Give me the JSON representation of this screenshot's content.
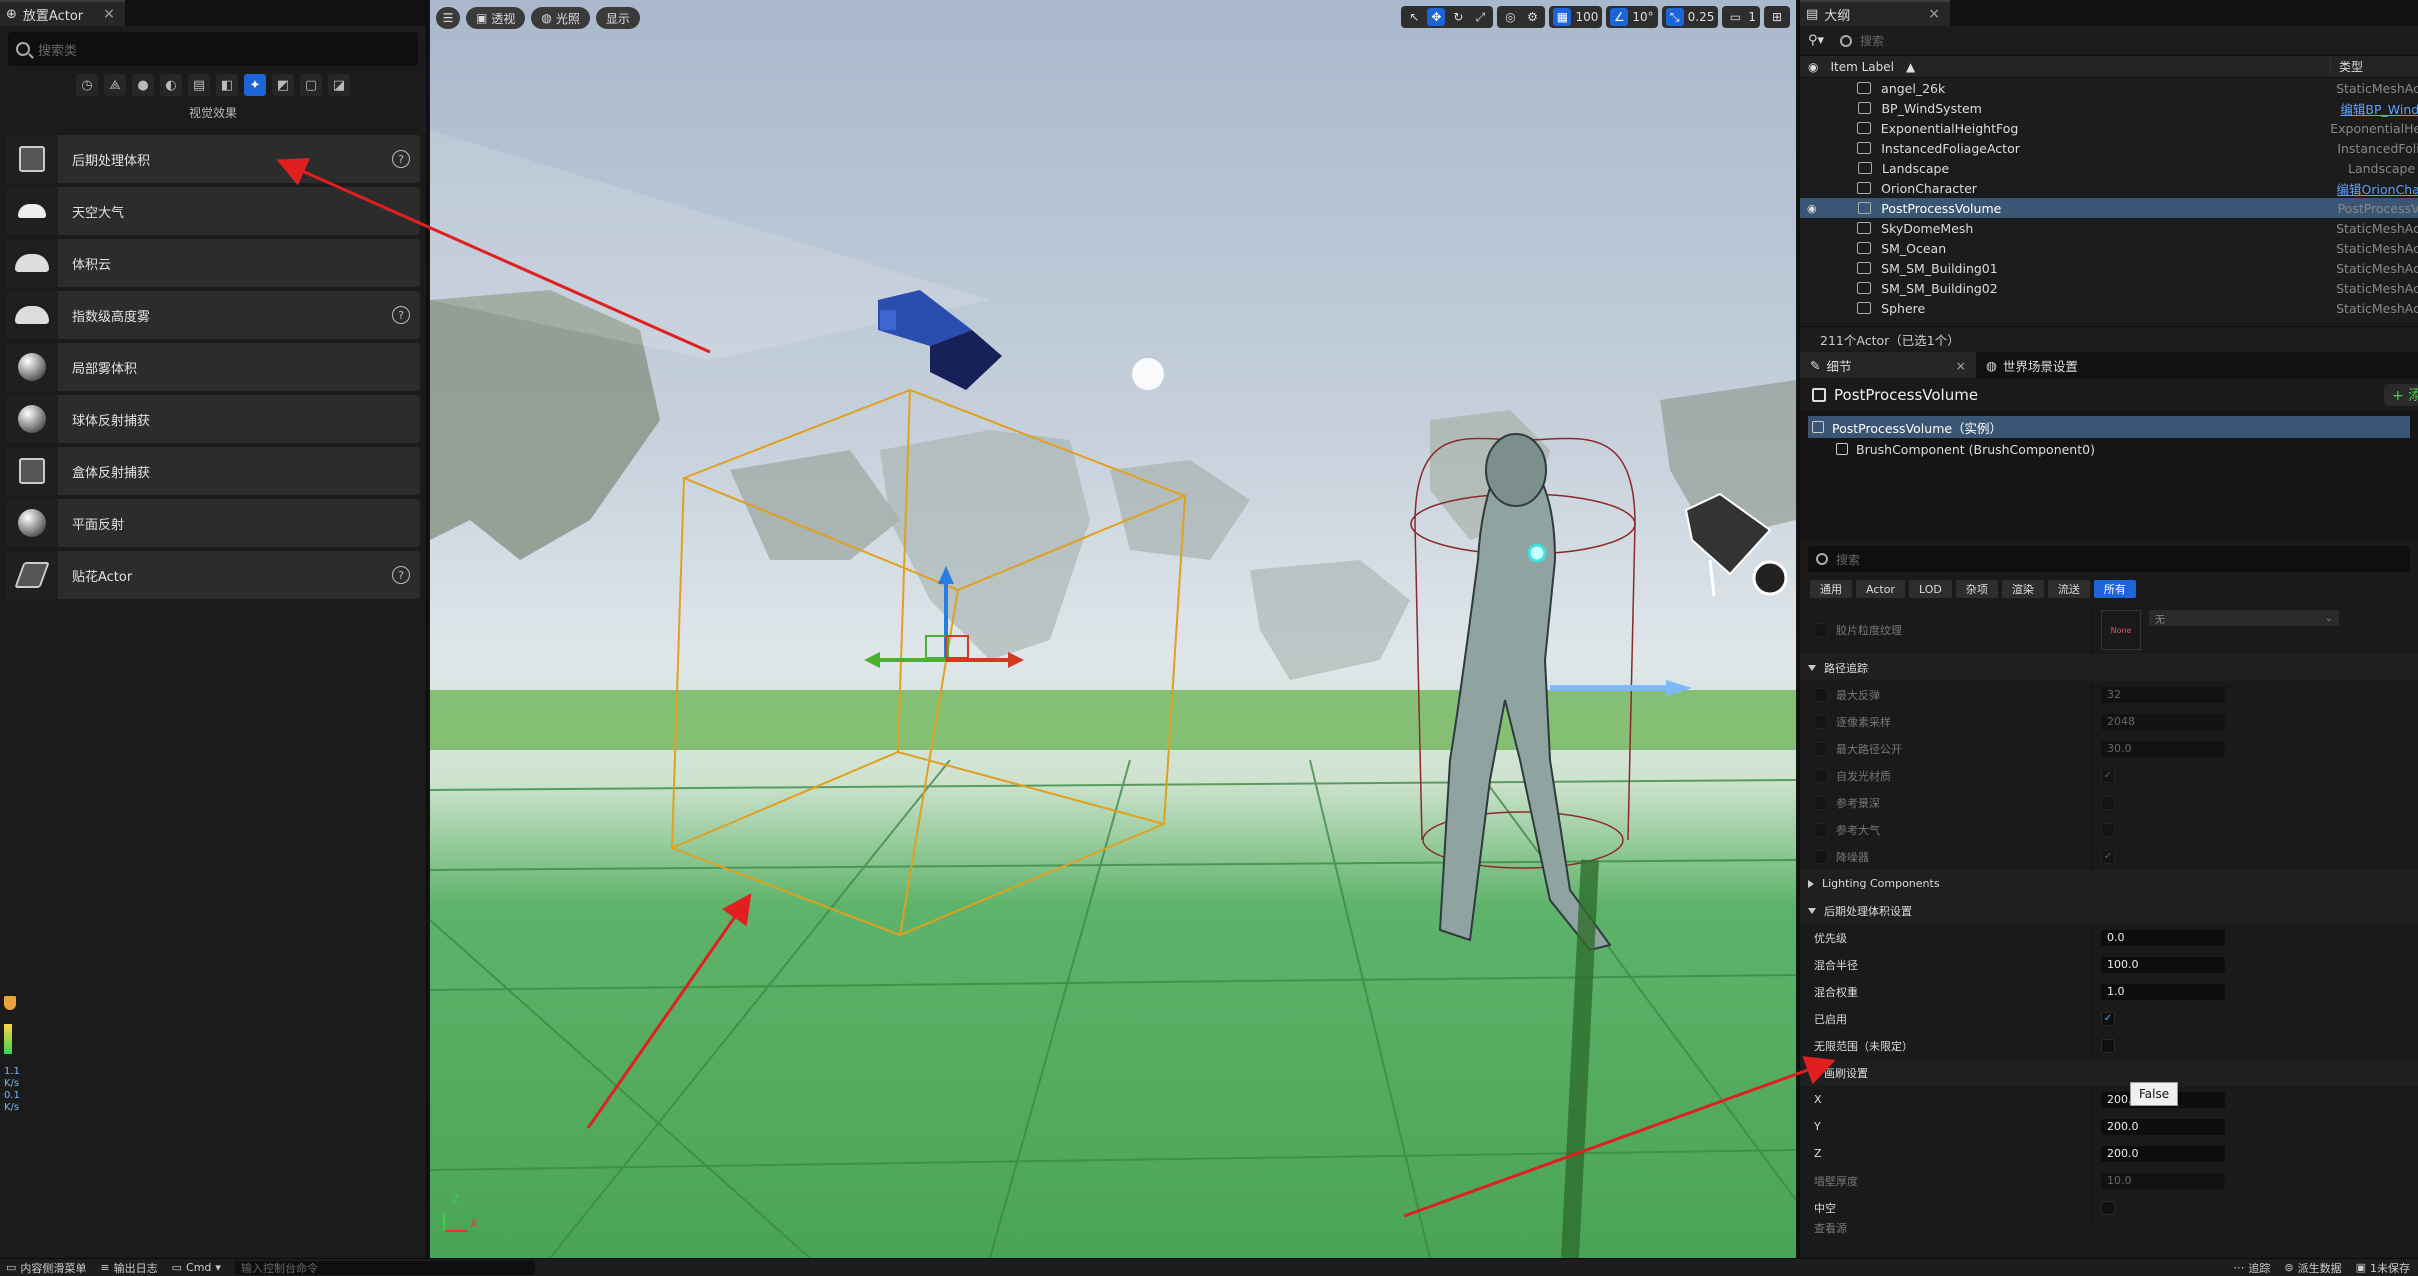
{
  "left_panel": {
    "tab_title": "放置Actor",
    "tab_close": "×",
    "search_placeholder": "搜索类",
    "category_icons": [
      "clock-icon",
      "shapes-icon",
      "light-icon",
      "cinematic-icon",
      "clapper-icon",
      "volume-icon",
      "visual-effects-icon",
      "geometry-icon",
      "all-classes-icon",
      "misc-icon"
    ],
    "category_label": "视觉效果",
    "items": [
      {
        "label": "后期处理体积",
        "thumb": "box",
        "help": "?"
      },
      {
        "label": "天空大气",
        "thumb": "sun",
        "help": ""
      },
      {
        "label": "体积云",
        "thumb": "cloud",
        "help": ""
      },
      {
        "label": "指数级高度雾",
        "thumb": "fog",
        "help": "?"
      },
      {
        "label": "局部雾体积",
        "thumb": "ball",
        "help": ""
      },
      {
        "label": "球体反射捕获",
        "thumb": "ball",
        "help": ""
      },
      {
        "label": "盒体反射捕获",
        "thumb": "box",
        "help": ""
      },
      {
        "label": "平面反射",
        "thumb": "ball",
        "help": ""
      },
      {
        "label": "贴花Actor",
        "thumb": "decal",
        "help": "?"
      }
    ],
    "stats": [
      "1.1",
      "K/s",
      "0.1",
      "K/s"
    ]
  },
  "viewport": {
    "toolbar": {
      "menu": "☰",
      "perspective": "透视",
      "lighting": "光照",
      "show": "显示",
      "grid_snap": "100",
      "rotate_snap": "10°",
      "scale_snap": "0.25",
      "camera_speed": "1"
    },
    "axis_z": "Z",
    "axis_x": "X"
  },
  "outliner": {
    "tab_title": "大纲",
    "tab_close": "×",
    "search_placeholder": "搜索",
    "col_label": "Item Label",
    "col_type": "类型",
    "rows": [
      {
        "name": "angel_26k",
        "type": "StaticMeshAc",
        "link": false,
        "selected": false
      },
      {
        "name": "BP_WindSystem",
        "type": "编辑BP_Wind",
        "link": true,
        "selected": false
      },
      {
        "name": "ExponentialHeightFog",
        "type": "ExponentialHe",
        "link": false,
        "selected": false
      },
      {
        "name": "InstancedFoliageActor",
        "type": "InstancedFoli",
        "link": false,
        "selected": false
      },
      {
        "name": "Landscape",
        "type": "Landscape",
        "link": false,
        "selected": false
      },
      {
        "name": "OrionCharacter",
        "type": "编辑OrionCha",
        "link": true,
        "selected": false
      },
      {
        "name": "PostProcessVolume",
        "type": "PostProcessV",
        "link": false,
        "selected": true
      },
      {
        "name": "SkyDomeMesh",
        "type": "StaticMeshAc",
        "link": false,
        "selected": false
      },
      {
        "name": "SM_Ocean",
        "type": "StaticMeshAc",
        "link": false,
        "selected": false
      },
      {
        "name": "SM_SM_Building01",
        "type": "StaticMeshAc",
        "link": false,
        "selected": false
      },
      {
        "name": "SM_SM_Building02",
        "type": "StaticMeshAc",
        "link": false,
        "selected": false
      },
      {
        "name": "Sphere",
        "type": "StaticMeshAc",
        "link": false,
        "selected": false
      }
    ],
    "count": "211个Actor（已选1个）"
  },
  "details": {
    "tab_details": "细节",
    "tab_world": "世界场景设置",
    "tab_close": "×",
    "object_name": "PostProcessVolume",
    "add_label": "+ 添",
    "components": [
      {
        "label": "PostProcessVolume（实例）",
        "selected": true
      },
      {
        "label": "BrushComponent (BrushComponent0)",
        "selected": false
      }
    ],
    "search_placeholder": "搜索",
    "filter_tabs": [
      "通用",
      "Actor",
      "LOD",
      "杂项",
      "渲染",
      "流送",
      "所有"
    ],
    "active_filter": "所有",
    "film_grain": {
      "label": "胶片粒度纹理",
      "tex": "None",
      "dropdown": "无"
    },
    "path_tracing_section": "路径追踪",
    "path_tracing": [
      {
        "label": "最大反弹",
        "value": "32"
      },
      {
        "label": "逐像素采样",
        "value": "2048"
      },
      {
        "label": "最大路径公开",
        "value": "30.0"
      },
      {
        "label": "自发光材质",
        "check": "✓"
      },
      {
        "label": "参考景深",
        "check": ""
      },
      {
        "label": "参考大气",
        "check": ""
      },
      {
        "label": "降噪器",
        "check": "✓"
      }
    ],
    "lighting_section": "Lighting Components",
    "ppv_section": "后期处理体积设置",
    "ppv": [
      {
        "label": "优先级",
        "value": "0.0"
      },
      {
        "label": "混合半径",
        "value": "100.0"
      },
      {
        "label": "混合权重",
        "value": "1.0"
      },
      {
        "label": "已启用",
        "check": "✓"
      },
      {
        "label": "无限范围（未限定）",
        "check": ""
      }
    ],
    "tooltip": "False",
    "brush_section": "画刷设置",
    "brush": [
      {
        "label": "X",
        "value": "200.0"
      },
      {
        "label": "Y",
        "value": "200.0"
      },
      {
        "label": "Z",
        "value": "200.0"
      },
      {
        "label": "墙壁厚度",
        "value": "10.0"
      },
      {
        "label": "中空",
        "check": ""
      }
    ],
    "last_row": "查看源"
  },
  "bottom_bar": {
    "content_drawer": "内容侧滑菜单",
    "output_log": "输出日志",
    "cmd": "Cmd",
    "console_placeholder": "输入控制台命令",
    "trace": "追踪",
    "derived_data": "派生数据",
    "saved": "1未保存"
  },
  "colors": {
    "accent": "#1d64d8",
    "selection": "#3b5574",
    "arrow": "#e02020",
    "gizmo_box": "#e0a020"
  }
}
